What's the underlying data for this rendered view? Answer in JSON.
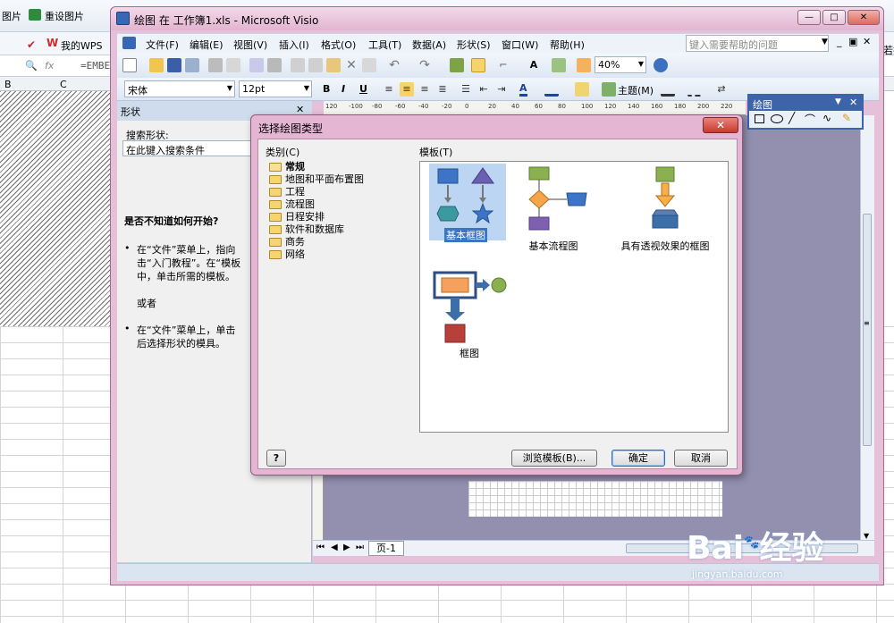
{
  "background": {
    "toolbar1": {
      "btn_images": "图片",
      "btn_reset_picture": "重设图片"
    },
    "toolbar2": {
      "mywps": "我的WPS"
    },
    "formula": {
      "fx": "fx",
      "value": "=EMBE"
    },
    "columns": [
      "B",
      "C"
    ],
    "right_cut_text": "若找"
  },
  "window": {
    "title": "绘图 在 工作簿1.xls - Microsoft Visio",
    "btn_minimize": "—",
    "btn_restore": "□",
    "btn_close": "✕"
  },
  "menu": {
    "items": [
      "文件(F)",
      "编辑(E)",
      "视图(V)",
      "插入(I)",
      "格式(O)",
      "工具(T)",
      "数据(A)",
      "形状(S)",
      "窗口(W)",
      "帮助(H)"
    ],
    "help_search_placeholder": "键入需要帮助的问题"
  },
  "toolbar": {
    "zoom": "40%",
    "font": "宋体",
    "font_size": "12pt",
    "bold": "B",
    "italic": "I",
    "underline": "U",
    "theme": "主题(M)",
    "font_color": "A"
  },
  "shapes_pane": {
    "title": "形状",
    "search_label": "搜索形状:",
    "search_placeholder": "在此键入搜索条件",
    "help_heading": "是否不知道如何开始?",
    "bullet1_line1": "在“文件”菜单上，指向",
    "bullet1_line2": "击“入门教程”。在“模板",
    "bullet1_line3": "中，单击所需的模板。",
    "or": "或者",
    "bullet2_line1": "在“文件”菜单上，单击",
    "bullet2_line2": "后选择形状的模具。"
  },
  "drawing_palette": {
    "title": "绘图"
  },
  "ruler_ticks": [
    "120",
    "-100",
    "-80",
    "-60",
    "-40",
    "-20",
    "0",
    "20",
    "40",
    "60",
    "80",
    "100",
    "120",
    "140",
    "160",
    "180",
    "200",
    "220"
  ],
  "page_tab": "页-1",
  "dialog": {
    "title": "选择绘图类型",
    "category_label": "类别(C)",
    "template_label": "模板(T)",
    "categories": [
      "常规",
      "地图和平面布置图",
      "工程",
      "流程图",
      "日程安排",
      "软件和数据库",
      "商务",
      "网络"
    ],
    "templates": [
      "基本框图",
      "基本流程图",
      "具有透视效果的框图",
      "框图"
    ],
    "btn_browse": "浏览模板(B)...",
    "btn_ok": "确定",
    "btn_cancel": "取消",
    "help_icon": "?"
  },
  "watermark": {
    "brand": "Bai",
    "cn": "经验",
    "url": "jingyan.baidu.com"
  }
}
